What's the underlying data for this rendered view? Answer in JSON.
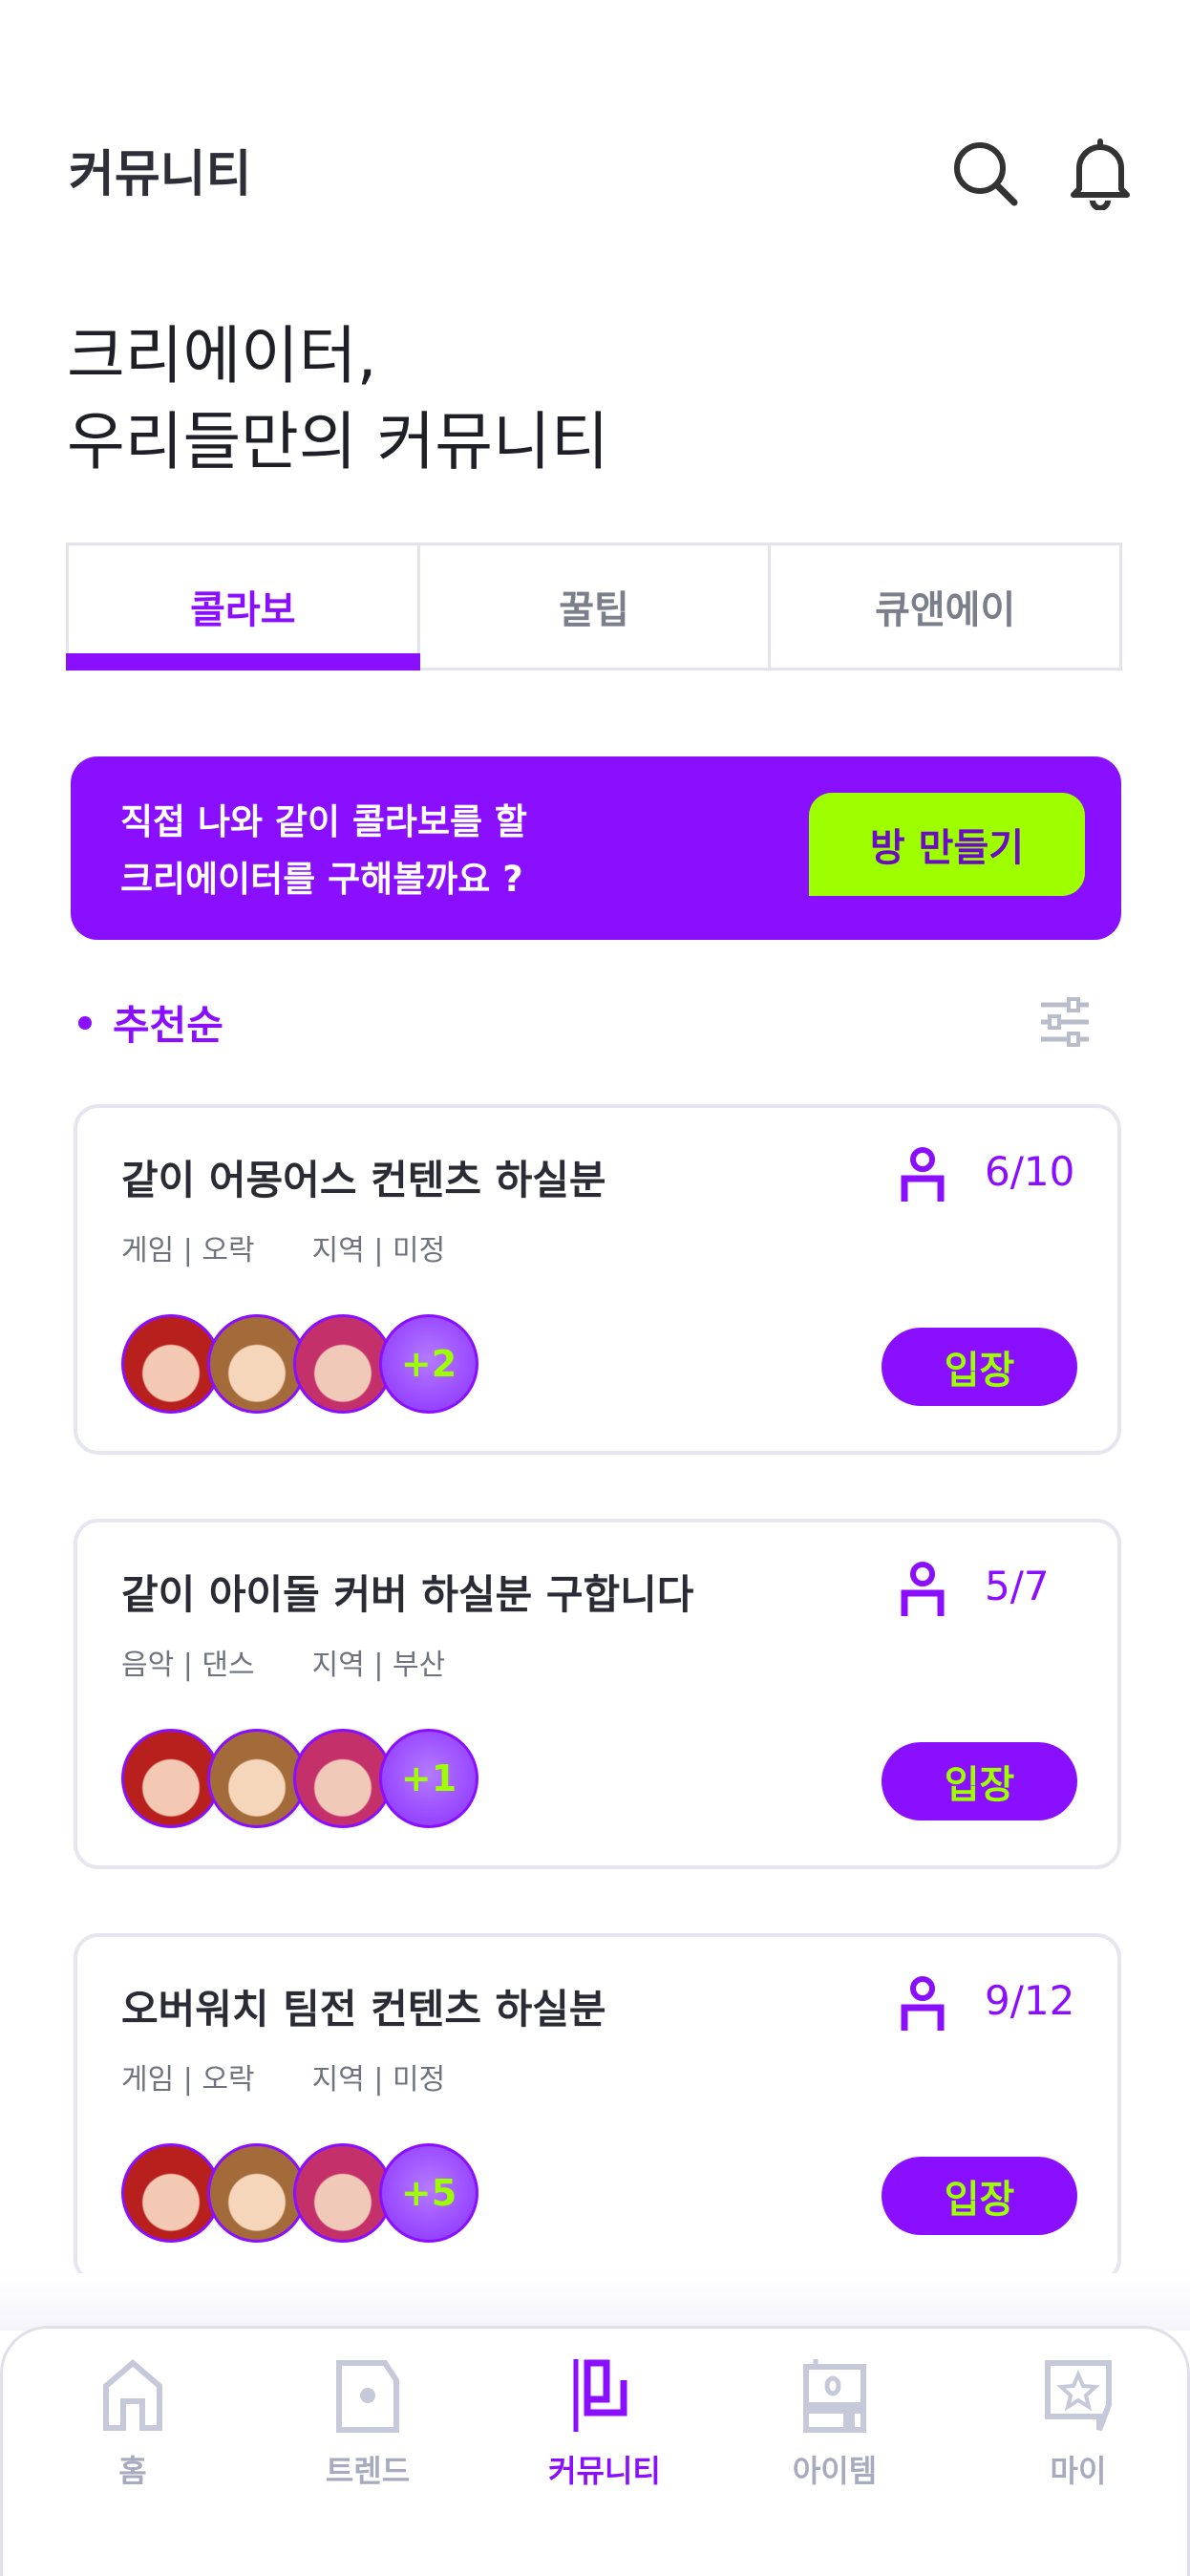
{
  "header": {
    "title": "커뮤니티",
    "icons": [
      "search-icon",
      "bell-icon"
    ]
  },
  "hero": {
    "line1": "크리에이터,",
    "line2": "우리들만의 커뮤니티"
  },
  "tabs": [
    {
      "label": "콜라보",
      "active": true
    },
    {
      "label": "꿀팁",
      "active": false
    },
    {
      "label": "큐앤에이",
      "active": false
    }
  ],
  "banner": {
    "line1": "직접 나와 같이 콜라보를 할",
    "line2": "크리에이터를 구해볼까요 ?",
    "button": "방 만들기"
  },
  "sort": {
    "label": "추천순",
    "icon": "filter-icon"
  },
  "rooms": [
    {
      "title": "같이 어몽어스 컨텐츠 하실분",
      "count": "6/10",
      "category": "게임 | 오락",
      "region": "지역 | 미정",
      "more": "+2",
      "enter": "입장"
    },
    {
      "title": "같이 아이돌 커버 하실분 구합니다",
      "count": "5/7",
      "category": "음악 | 댄스",
      "region": "지역 | 부산",
      "more": "+1",
      "enter": "입장"
    },
    {
      "title": "오버워치 팀전 컨텐츠 하실분",
      "count": "9/12",
      "category": "게임 | 오락",
      "region": "지역 | 미정",
      "more": "+5",
      "enter": "입장"
    }
  ],
  "nav": [
    {
      "label": "홈",
      "icon": "home-icon"
    },
    {
      "label": "트렌드",
      "icon": "trend-icon"
    },
    {
      "label": "커뮤니티",
      "icon": "community-icon",
      "active": true
    },
    {
      "label": "아이템",
      "icon": "item-icon"
    },
    {
      "label": "마이",
      "icon": "my-icon"
    }
  ],
  "colors": {
    "accent": "#8a0fff",
    "lime": "#9eff00",
    "navInactive": "#a7abbf"
  }
}
